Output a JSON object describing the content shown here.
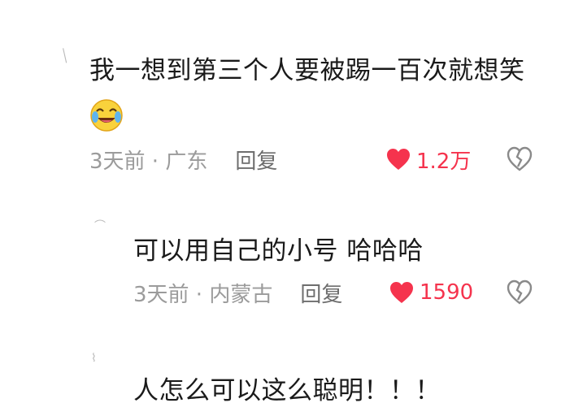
{
  "comments": [
    {
      "text": "我一想到第三个人要被踢一百次就想笑",
      "emoji": "laughing-crying-emoji",
      "time_location": "3天前 · 广东",
      "reply_label": "回复",
      "like_count": "1.2万"
    },
    {
      "text": "可以用自己的小号 哈哈哈",
      "time_location": "3天前 · 内蒙古",
      "reply_label": "回复",
      "like_count": "1590"
    },
    {
      "text": "人怎么可以这么聪明！！！"
    }
  ],
  "icons": {
    "like": "heart-filled-icon",
    "dislike": "broken-heart-icon"
  },
  "colors": {
    "like_accent": "#f5334d",
    "meta_gray": "#9b9b9b",
    "text_dark": "#1a1a1a"
  }
}
